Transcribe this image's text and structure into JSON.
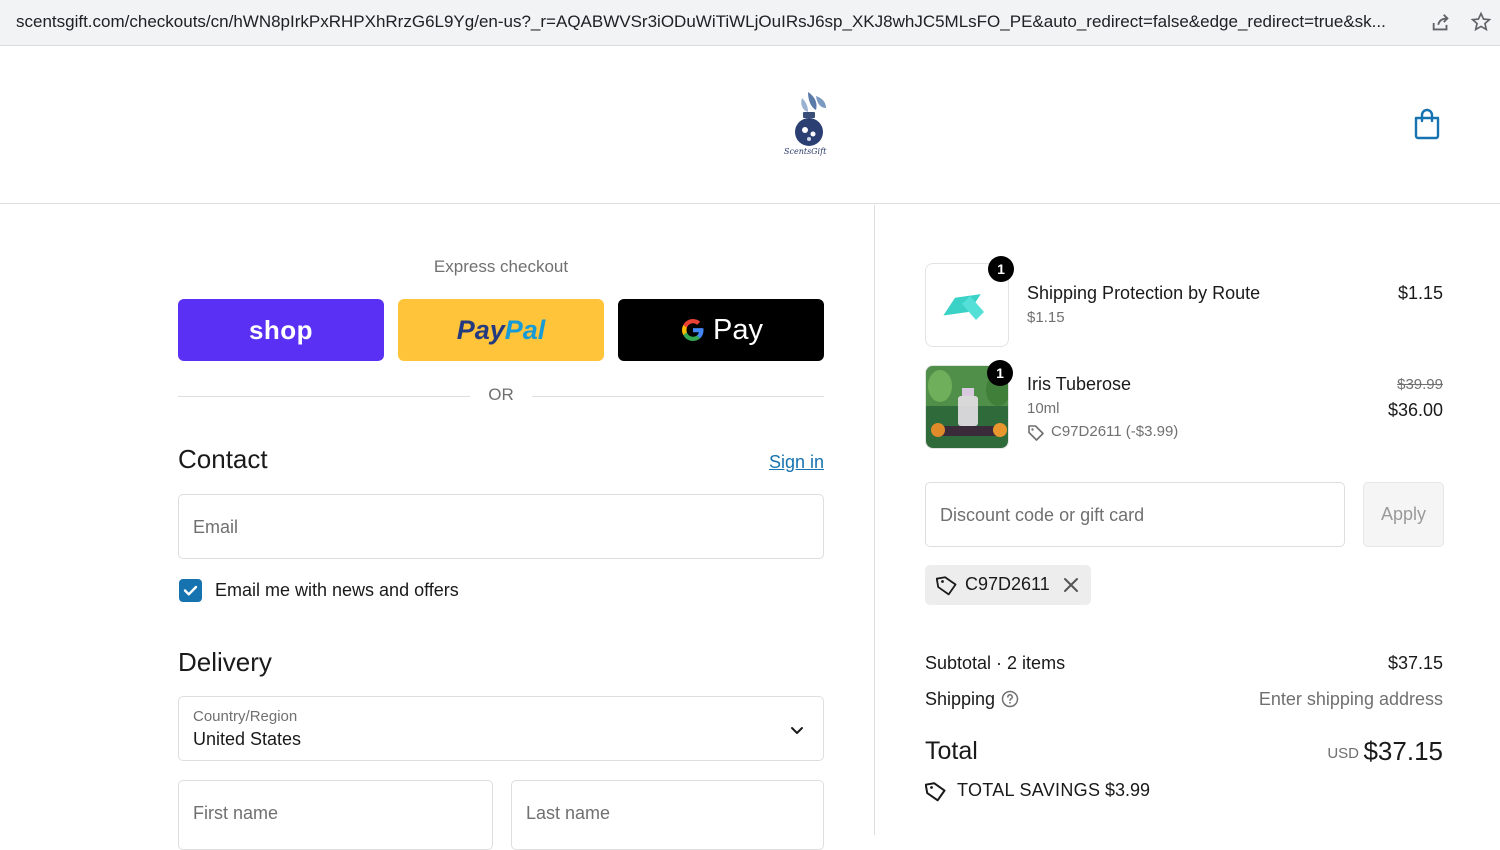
{
  "browser": {
    "url": "scentsgift.com/checkouts/cn/hWN8pIrkPxRHPXhRrzG6L9Yg/en-us?_r=AQABWVSr3iODuWiTiWLjOuIRsJ6sp_XKJ8whJC5MLsFO_PE&auto_redirect=false&edge_redirect=true&sk..."
  },
  "header": {
    "logo_text": "ScentsGift",
    "cart_icon": "shopping-bag-icon"
  },
  "express": {
    "title": "Express checkout",
    "shop_label": "shop",
    "paypal_label_1": "Pay",
    "paypal_label_2": "Pal",
    "gpay_label": "Pay",
    "or_text": "OR"
  },
  "contact": {
    "title": "Contact",
    "sign_in": "Sign in",
    "email_placeholder": "Email",
    "newsletter_label": "Email me with news and offers",
    "newsletter_checked": true
  },
  "delivery": {
    "title": "Delivery",
    "country_label": "Country/Region",
    "country_value": "United States",
    "first_name_placeholder": "First name",
    "last_name_placeholder": "Last name"
  },
  "order": {
    "items": [
      {
        "qty": "1",
        "name": "Shipping Protection by Route",
        "sub": "$1.15",
        "price": "$1.15"
      },
      {
        "qty": "1",
        "name": "Iris Tuberose",
        "sub": "10ml",
        "discount": "C97D2611 (-$3.99)",
        "old_price": "$39.99",
        "price": "$36.00"
      }
    ],
    "discount_placeholder": "Discount code or gift card",
    "apply_label": "Apply",
    "applied_code": "C97D2611",
    "subtotal_label": "Subtotal · 2 items",
    "subtotal_value": "$37.15",
    "shipping_label": "Shipping",
    "shipping_value": "Enter shipping address",
    "total_label": "Total",
    "total_currency": "USD",
    "total_value": "$37.15",
    "savings_label": "TOTAL SAVINGS",
    "savings_value": "$3.99"
  },
  "colors": {
    "shop": "#5a31f4",
    "paypal": "#ffc439",
    "gpay": "#000000",
    "link": "#1773b0",
    "accent_bag": "#1773b0"
  }
}
